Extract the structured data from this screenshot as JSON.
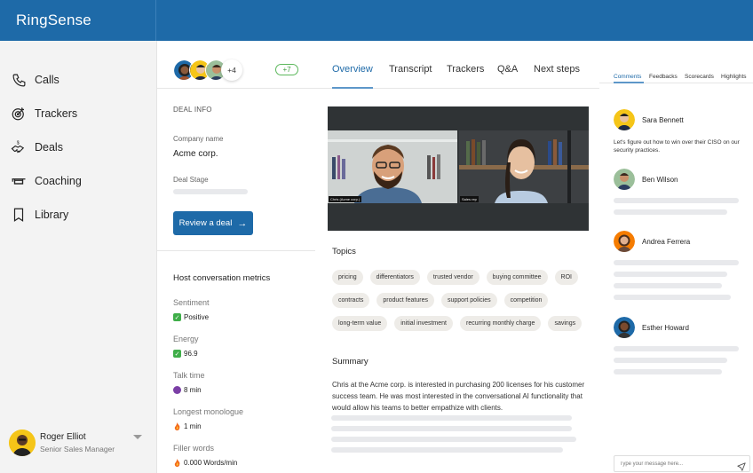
{
  "app": {
    "brand": "RingSense"
  },
  "sidebar": {
    "items": [
      {
        "label": "Calls",
        "icon": "phone-icon"
      },
      {
        "label": "Trackers",
        "icon": "target-icon"
      },
      {
        "label": "Deals",
        "icon": "handshake-dollar-icon"
      },
      {
        "label": "Coaching",
        "icon": "graduation-cap-icon"
      },
      {
        "label": "Library",
        "icon": "bookmark-icon"
      }
    ],
    "user": {
      "name": "Roger Elliot",
      "role": "Senior Sales Manager"
    }
  },
  "deal": {
    "participants_more": "+4",
    "new_badge": "+7",
    "section_title": "DEAL INFO",
    "company_label": "Company name",
    "company_value": "Acme corp.",
    "stage_label": "Deal Stage",
    "review_button": "Review a deal",
    "metrics_title": "Host conversation metrics",
    "metrics": [
      {
        "label": "Sentiment",
        "value": "Positive",
        "icon": "check-icon"
      },
      {
        "label": "Energy",
        "value": "96.9",
        "icon": "check-icon"
      },
      {
        "label": "Talk time",
        "value": "8 min",
        "icon": "devil-icon"
      },
      {
        "label": "Longest monologue",
        "value": "1 min",
        "icon": "fire-icon"
      },
      {
        "label": "Filler words",
        "value": "0.000 Words/min",
        "icon": "fire-icon"
      }
    ]
  },
  "main": {
    "tabs": [
      {
        "label": "Overview",
        "active": true
      },
      {
        "label": "Transcript",
        "active": false
      },
      {
        "label": "Trackers",
        "active": false
      },
      {
        "label": "Q&A",
        "active": false
      },
      {
        "label": "Next steps",
        "active": false
      }
    ],
    "video": {
      "tiles": [
        {
          "caption": "Chris (Acme corp.)"
        },
        {
          "caption": "Sales rep"
        }
      ]
    },
    "topics_title": "Topics",
    "topics": [
      [
        "pricing",
        "differentiators",
        "trusted vendor",
        "buying committee",
        "ROI"
      ],
      [
        "contracts",
        "product features",
        "support policies",
        "competition"
      ],
      [
        "long-term value",
        "initial investment",
        "recurring monthly charge",
        "savings"
      ]
    ],
    "summary_title": "Summary",
    "summary_text": "Chris at the Acme corp. is interested in purchasing 200 licenses for his customer success team. He was most interested in the conversational AI functionality that would allow his teams to better empathize with clients."
  },
  "right": {
    "tabs": [
      {
        "label": "Comments",
        "active": true
      },
      {
        "label": "Feedbacks",
        "active": false
      },
      {
        "label": "Scorecards",
        "active": false
      },
      {
        "label": "Highlights",
        "active": false
      }
    ],
    "comments": [
      {
        "name": "Sara Bennett",
        "text": "Let's figure out how to win over their CISO on our security practices."
      },
      {
        "name": "Ben Wilson",
        "text": ""
      },
      {
        "name": "Andrea Ferrera",
        "text": ""
      },
      {
        "name": "Esther Howard",
        "text": ""
      }
    ],
    "message_placeholder": "Type your message here..."
  },
  "colors": {
    "brand": "#1e6aa8",
    "accent_tab": "#5d97c9",
    "success": "#5cb85c"
  }
}
